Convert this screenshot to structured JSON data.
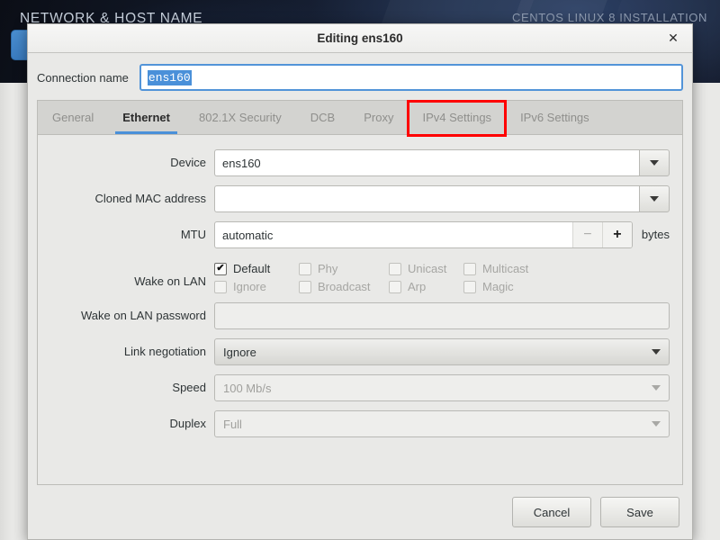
{
  "backdrop": {
    "screen_title": "NETWORK & HOST NAME",
    "product_title": "CENTOS LINUX 8 INSTALLATION",
    "panel_text": ""
  },
  "dialog": {
    "title": "Editing ens160",
    "close_icon": "close-icon",
    "close_glyph": "✕"
  },
  "connection": {
    "label": "Connection name",
    "value": "ens160",
    "selected": true
  },
  "tabs": {
    "items": [
      {
        "label": "General",
        "active": false
      },
      {
        "label": "Ethernet",
        "active": true
      },
      {
        "label": "802.1X Security",
        "active": false
      },
      {
        "label": "DCB",
        "active": false
      },
      {
        "label": "Proxy",
        "active": false
      },
      {
        "label": "IPv4 Settings",
        "active": false
      },
      {
        "label": "IPv6 Settings",
        "active": false
      }
    ],
    "highlight_tab": "IPv4 Settings",
    "highlight_color": "#ff0000",
    "active_underline_color": "#4a90d9"
  },
  "form": {
    "device": {
      "label": "Device",
      "value": "ens160",
      "dropdown_icon": "chevron-down-icon"
    },
    "cloned_mac": {
      "label": "Cloned MAC address",
      "value": "",
      "dropdown_icon": "chevron-down-icon"
    },
    "mtu": {
      "label": "MTU",
      "value": "automatic",
      "minus_glyph": "−",
      "plus_glyph": "+",
      "unit": "bytes"
    },
    "wake_on_lan": {
      "label": "Wake on LAN",
      "options": [
        {
          "label": "Default",
          "checked": true,
          "enabled": true
        },
        {
          "label": "Phy",
          "checked": false,
          "enabled": false
        },
        {
          "label": "Unicast",
          "checked": false,
          "enabled": false
        },
        {
          "label": "Multicast",
          "checked": false,
          "enabled": false
        },
        {
          "label": "Ignore",
          "checked": false,
          "enabled": false
        },
        {
          "label": "Broadcast",
          "checked": false,
          "enabled": false
        },
        {
          "label": "Arp",
          "checked": false,
          "enabled": false
        },
        {
          "label": "Magic",
          "checked": false,
          "enabled": false
        }
      ],
      "check_glyph": "✔"
    },
    "wol_password": {
      "label": "Wake on LAN password",
      "value": "",
      "enabled": false
    },
    "link_negotiation": {
      "label": "Link negotiation",
      "value": "Ignore",
      "enabled": true,
      "dropdown_icon": "chevron-down-icon"
    },
    "speed": {
      "label": "Speed",
      "value": "100 Mb/s",
      "enabled": false,
      "dropdown_icon": "chevron-down-icon"
    },
    "duplex": {
      "label": "Duplex",
      "value": "Full",
      "enabled": false,
      "dropdown_icon": "chevron-down-icon"
    }
  },
  "footer": {
    "cancel_label": "Cancel",
    "save_label": "Save"
  }
}
